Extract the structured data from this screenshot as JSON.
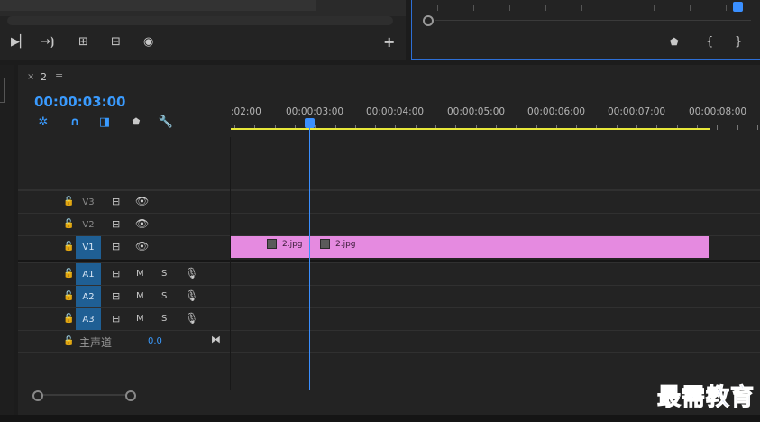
{
  "source_monitor": {
    "controls": [
      "step-forward",
      "insert",
      "lift",
      "extract",
      "export-frame",
      "add"
    ]
  },
  "program_monitor": {
    "controls": [
      "marker",
      "mark-in",
      "mark-out"
    ]
  },
  "timeline": {
    "tab_label": "2",
    "timecode": "00:00:03:00",
    "ruler_labels": [
      ":02:00",
      "00:00:03:00",
      "00:00:04:00",
      "00:00:05:00",
      "00:00:06:00",
      "00:00:07:00",
      "00:00:08:00"
    ],
    "video_tracks": [
      {
        "name": "V3",
        "active": false
      },
      {
        "name": "V2",
        "active": false
      },
      {
        "name": "V1",
        "active": true
      }
    ],
    "audio_tracks": [
      {
        "name": "A1",
        "m": "M",
        "s": "S"
      },
      {
        "name": "A2",
        "m": "M",
        "s": "S"
      },
      {
        "name": "A3",
        "m": "M",
        "s": "S"
      }
    ],
    "master": {
      "label": "主声道",
      "value": "0.0"
    },
    "clips": [
      {
        "name": "2.jpg",
        "color": "#e58ae0"
      },
      {
        "name": "2.jpg",
        "color": "#e58ae0"
      }
    ]
  },
  "watermark": "最需教育",
  "colors": {
    "accent": "#3a9bff",
    "clip": "#e58ae0",
    "workarea": "#e8e83a"
  }
}
